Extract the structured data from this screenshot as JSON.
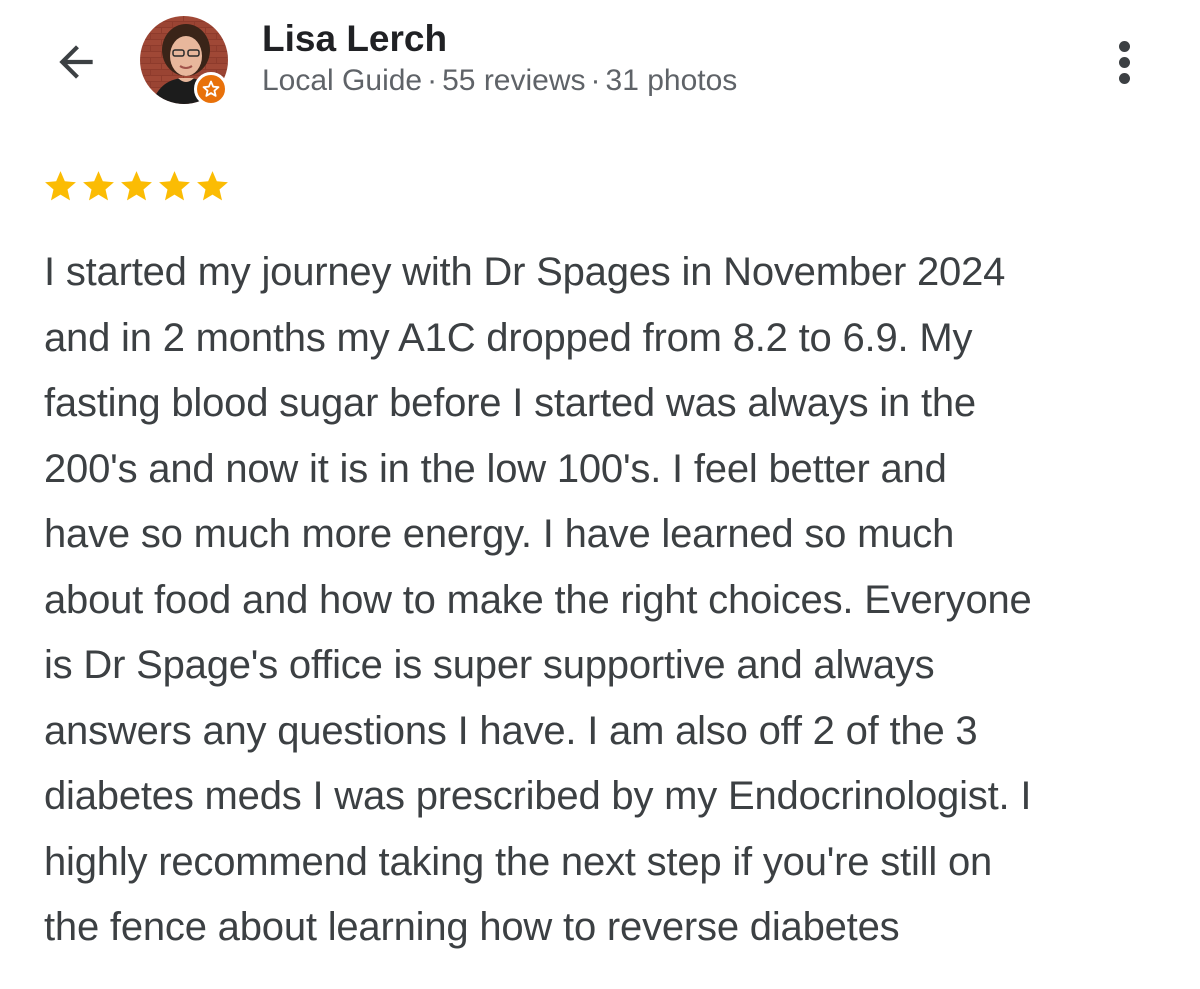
{
  "reviewer": {
    "name": "Lisa Lerch",
    "badge": "Local Guide",
    "separator": "·",
    "reviews": "55 reviews",
    "photos": "31 photos"
  },
  "icons": {
    "back": "arrow-left-icon",
    "more": "more-vert-icon",
    "star": "star-icon",
    "badge": "local-guide-star-icon"
  },
  "rating": {
    "stars": 5,
    "max": 5
  },
  "colors": {
    "star": "#fbbc04",
    "badge": "#e8710a",
    "name": "#202124",
    "meta": "#5f6368",
    "text": "#3c4043"
  },
  "review": {
    "text": "I started my journey with Dr Spages in November 2024\nand in 2 months my A1C dropped from 8.2 to 6.9. My\nfasting blood sugar before I started was always in the\n200's and now it is in the low 100's. I feel better and\nhave so much more energy. I have learned so much\nabout food and how to make the right choices. Everyone\nis Dr Spage's office is super supportive and always\nanswers any questions I have. I am also off 2 of the 3\ndiabetes meds I was prescribed by my Endocrinologist. I\nhighly recommend taking the next step if you're still on\nthe fence about learning how to reverse diabetes"
  }
}
